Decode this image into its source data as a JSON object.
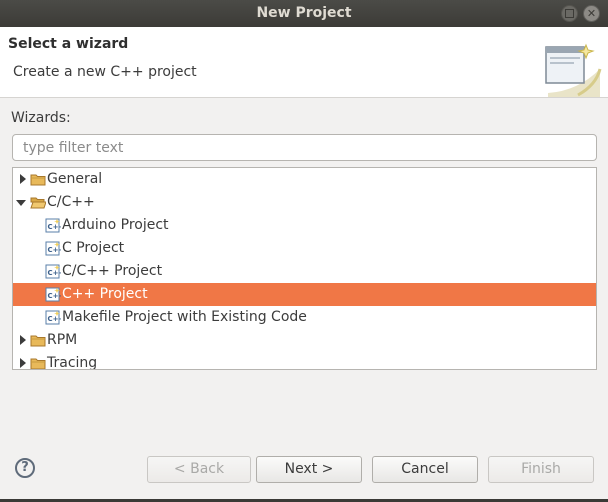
{
  "window": {
    "title": "New Project"
  },
  "header": {
    "title": "Select a wizard",
    "description": "Create a new C++ project"
  },
  "wizards_label": "Wizards:",
  "filter": {
    "placeholder": "type filter text",
    "value": ""
  },
  "tree": [
    {
      "label": "General",
      "level": 0,
      "expanded": false,
      "icon": "folder-icon",
      "selected": false
    },
    {
      "label": "C/C++",
      "level": 0,
      "expanded": true,
      "icon": "folder-open-icon",
      "selected": false
    },
    {
      "label": "Arduino Project",
      "level": 1,
      "icon": "cpp-project-icon",
      "selected": false
    },
    {
      "label": "C Project",
      "level": 1,
      "icon": "cpp-project-icon",
      "selected": false
    },
    {
      "label": "C/C++ Project",
      "level": 1,
      "icon": "cpp-project-icon",
      "selected": false
    },
    {
      "label": "C++ Project",
      "level": 1,
      "icon": "cpp-project-icon",
      "selected": true
    },
    {
      "label": "Makefile Project with Existing Code",
      "level": 1,
      "icon": "cpp-project-icon",
      "selected": false
    },
    {
      "label": "RPM",
      "level": 0,
      "expanded": false,
      "icon": "folder-icon",
      "selected": false
    },
    {
      "label": "Tracing",
      "level": 0,
      "expanded": false,
      "icon": "folder-icon",
      "selected": false
    }
  ],
  "buttons": {
    "help": "?",
    "back": "< Back",
    "next": "Next >",
    "cancel": "Cancel",
    "finish": "Finish"
  },
  "colors": {
    "selection": "#f07746",
    "titlebar": "#3c3b37"
  }
}
